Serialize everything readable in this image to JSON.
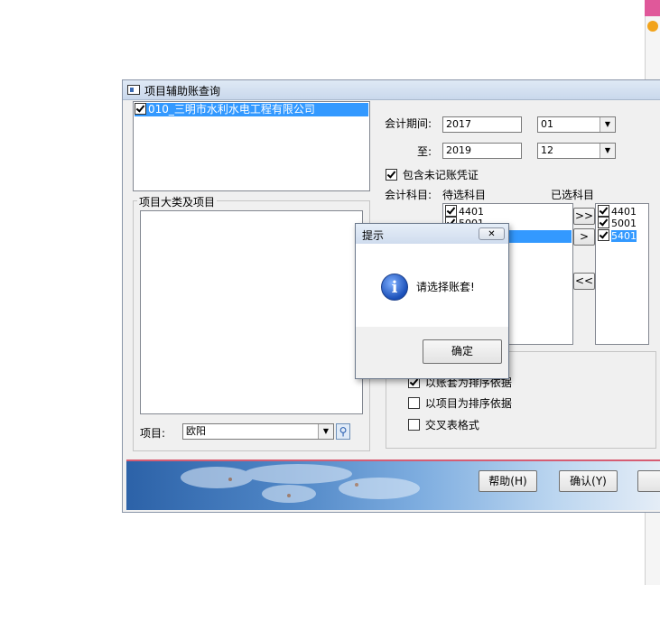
{
  "window": {
    "title": "项目辅助账查询",
    "account_list": [
      {
        "label": "010_三明市水利水电工程有限公司",
        "checked": true,
        "selected": true
      }
    ],
    "project_group": {
      "legend": "项目大类及项目",
      "project_label": "项目:",
      "project_value": "欧阳"
    },
    "period": {
      "label_from": "会计期间:",
      "label_to": "至:",
      "year_from": "2017",
      "month_from": "01",
      "year_to": "2019",
      "month_to": "12"
    },
    "include_unposted_label": "包含未记账凭证",
    "subject_label": "会计科目:",
    "pending_label": "待选科目",
    "selected_label": "已选科目",
    "pending_items": [
      {
        "label": "4401",
        "checked": true
      },
      {
        "label": "5001",
        "checked": true
      }
    ],
    "selected_items": [
      {
        "label": "4401",
        "checked": true,
        "selected": false
      },
      {
        "label": "5001",
        "checked": true,
        "selected": false
      },
      {
        "label": "5401",
        "checked": true,
        "selected": true
      }
    ],
    "move_buttons": {
      "all_right": ">>",
      "right": ">",
      "all_left": "<<"
    },
    "sort_options": [
      {
        "label": "以账套为排序依据",
        "checked": true
      },
      {
        "label": "以项目为排序依据",
        "checked": false
      },
      {
        "label": "交叉表格式",
        "checked": false
      }
    ],
    "help_button": "帮助(H)",
    "confirm_button": "确认(Y)"
  },
  "dialog": {
    "title": "提示",
    "close_label": "✕",
    "message": "请选择账套!",
    "ok_button": "确定"
  }
}
